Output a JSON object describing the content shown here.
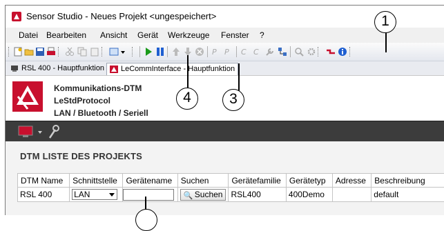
{
  "window": {
    "title": "Sensor Studio - Neues Projekt <ungespeichert>"
  },
  "menu": {
    "items": [
      "Datei",
      "Bearbeiten",
      "Ansicht",
      "Gerät",
      "Werkzeuge",
      "Fenster",
      "?"
    ]
  },
  "tabs": [
    {
      "label": "RSL 400 - Hauptfunktion",
      "active": false
    },
    {
      "label": "LeCommInterface - Hauptfunktion",
      "active": true
    }
  ],
  "header": {
    "line1": "Kommunikations-DTM",
    "line2": "LeStdProtocol",
    "line3": "LAN / Bluetooth / Seriell"
  },
  "section": {
    "title": "DTM LISTE DES PROJEKTS"
  },
  "table": {
    "columns": [
      "DTM Name",
      "Schnittstelle",
      "Gerätename",
      "Suchen",
      "Gerätefamilie",
      "Gerätetyp",
      "Adresse",
      "Beschreibung"
    ],
    "row": {
      "dtm_name": "RSL 400",
      "schnittstelle": "LAN",
      "geraetename": "",
      "suchen": "Suchen",
      "geraetefamilie": "RSL400",
      "geraetetyp": "400Demo",
      "adresse": "",
      "beschreibung": "default"
    }
  },
  "callouts": [
    "1",
    "3",
    "4"
  ],
  "colors": {
    "brand_red": "#c8102e",
    "dark_bar": "#3c3c3c",
    "play_green": "#1a9a1a",
    "pause_blue": "#1f5fd1"
  }
}
